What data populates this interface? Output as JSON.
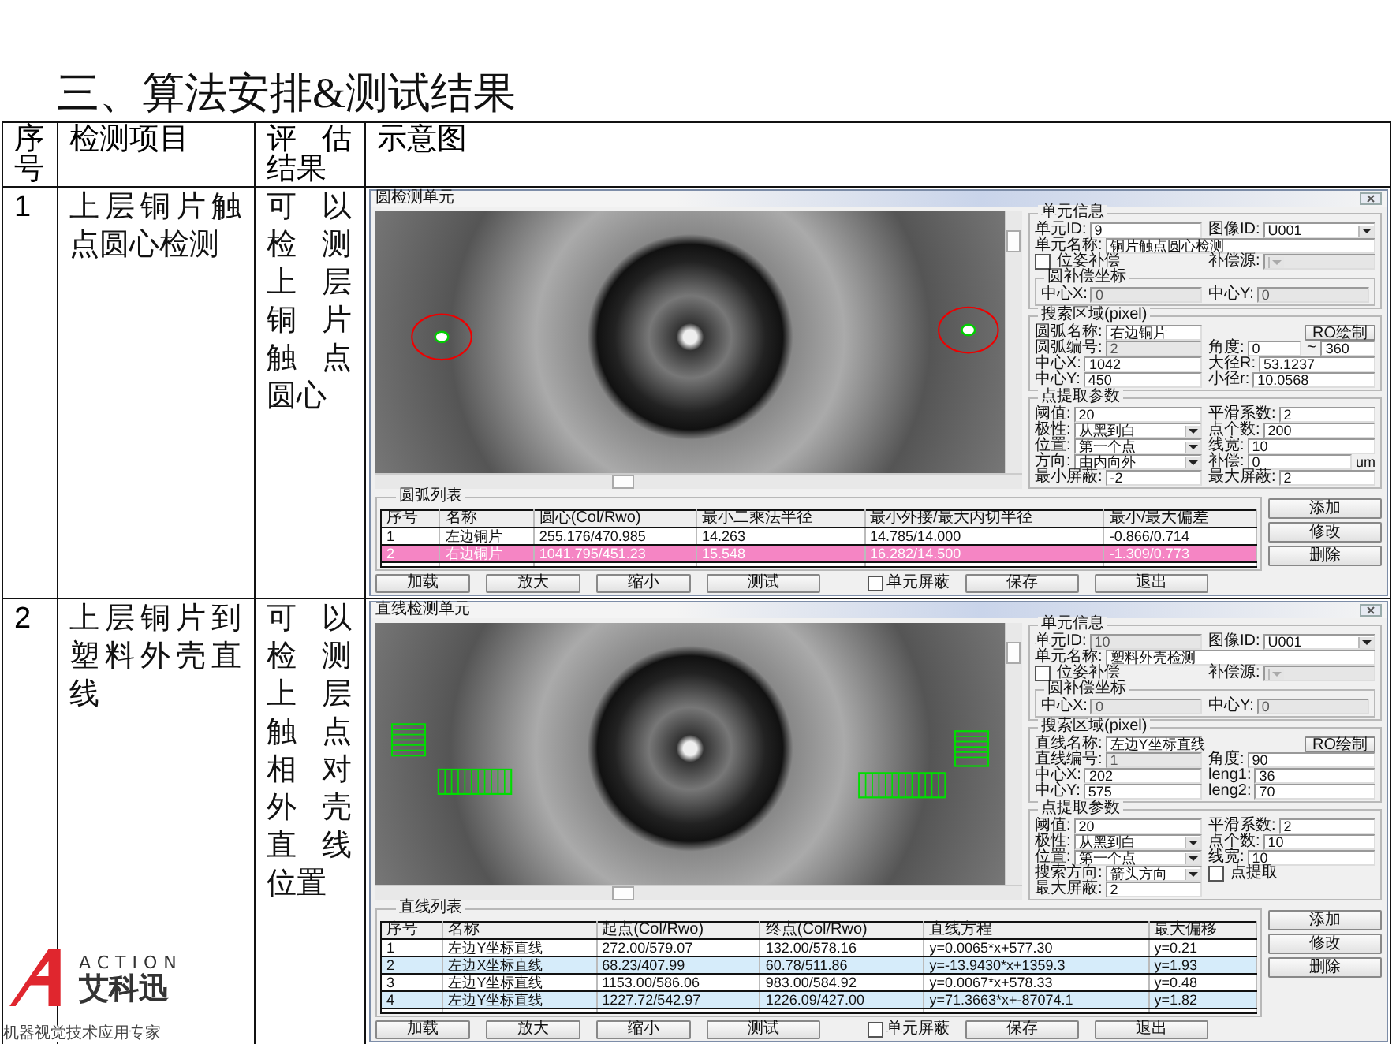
{
  "title": "三、算法安排&测试结果",
  "table": {
    "columns": [
      "序号",
      "检测项目",
      "评估结果",
      "示意图"
    ],
    "rows": [
      {
        "index": "1",
        "item": "上层铜片触点圆心检测",
        "result": "可以检测上层铜片触点圆心",
        "window": {
          "title": "圆检测单元",
          "kind": "circle",
          "groups": [
            {
              "title": "单元信息",
              "fields": [
                {
                  "kind": "input",
                  "label": "单元ID:",
                  "value": "9"
                },
                {
                  "kind": "select",
                  "label": "图像ID:",
                  "value": "U001"
                },
                {
                  "kind": "textline",
                  "label": "单元名称:",
                  "value": "铜片触点圆心检测"
                },
                {
                  "kind": "checkbox",
                  "label": "位姿补偿",
                  "checked": false
                },
                {
                  "kind": "select",
                  "label": "补偿源:",
                  "disabled": true
                }
              ],
              "sub": {
                "title": "圆补偿坐标",
                "fields": [
                  {
                    "kind": "input",
                    "label": "中心X:",
                    "value": "0",
                    "disabled": true
                  },
                  {
                    "kind": "input",
                    "label": "中心Y:",
                    "value": "0",
                    "disabled": true
                  }
                ]
              }
            },
            {
              "title": "搜索区域(pixel)",
              "fields": [
                {
                  "kind": "input",
                  "label": "圆弧名称:",
                  "value": "右边铜片"
                },
                {
                  "kind": "button",
                  "label": "RO绘制"
                },
                {
                  "kind": "input",
                  "label": "圆弧编号:",
                  "value": "2",
                  "disabled": true
                },
                {
                  "kind": "range",
                  "label": "角度:",
                  "value": "0",
                  "sep": "~",
                  "value2": "360"
                },
                {
                  "kind": "input",
                  "label": "中心X:",
                  "value": "1042"
                },
                {
                  "kind": "input",
                  "label": "大径R:",
                  "value": "53.1237"
                },
                {
                  "kind": "input",
                  "label": "中心Y:",
                  "value": "450"
                },
                {
                  "kind": "input",
                  "label": "小径r:",
                  "value": "10.0568"
                }
              ]
            },
            {
              "title": "点提取参数",
              "fields": [
                {
                  "kind": "input",
                  "label": "阈值:",
                  "value": "20"
                },
                {
                  "kind": "input",
                  "label": "平滑系数:",
                  "value": "2"
                },
                {
                  "kind": "select",
                  "label": "极性:",
                  "value": "从黑到白"
                },
                {
                  "kind": "input",
                  "label": "点个数:",
                  "value": "200"
                },
                {
                  "kind": "select",
                  "label": "位置:",
                  "value": "第一个点"
                },
                {
                  "kind": "input",
                  "label": "线宽:",
                  "value": "10"
                },
                {
                  "kind": "select",
                  "label": "方向:",
                  "value": "由内向外"
                },
                {
                  "kind": "input",
                  "label": "补偿:",
                  "value": "0",
                  "unit": "um"
                },
                {
                  "kind": "input",
                  "label": "最小屏蔽:",
                  "value": "-2"
                },
                {
                  "kind": "input",
                  "label": "最大屏蔽:",
                  "value": "2"
                }
              ]
            }
          ],
          "list": {
            "title": "圆弧列表",
            "columns": [
              "序号",
              "名称",
              "圆心(Col/Rwo)",
              "最小二乘法半径",
              "最小外接/最大内切半径",
              "最小/最大偏差"
            ],
            "rows": [
              {
                "cells": [
                  "1",
                  "左边铜片",
                  "255.176/470.985",
                  "14.263",
                  "14.785/14.000",
                  "-0.866/0.714"
                ],
                "selected": false
              },
              {
                "cells": [
                  "2",
                  "右边铜片",
                  "1041.795/451.23",
                  "15.548",
                  "16.282/14.500",
                  "-1.309/0.773"
                ],
                "selected": true
              }
            ]
          },
          "side_buttons": [
            "添加",
            "修改",
            "删除"
          ],
          "buttons": [
            "加载",
            "放大",
            "缩小",
            "测试"
          ],
          "mask": {
            "label": "单元屏蔽",
            "checked": false
          },
          "actions": [
            "保存",
            "退出"
          ]
        }
      },
      {
        "index": "2",
        "item": "上层铜片到塑料外壳直线",
        "result": "可以检测上层触点相对外壳直线位置",
        "window": {
          "title": "直线检测单元",
          "kind": "line",
          "groups": [
            {
              "title": "单元信息",
              "fields": [
                {
                  "kind": "input",
                  "label": "单元ID:",
                  "value": "10",
                  "disabled": true
                },
                {
                  "kind": "select",
                  "label": "图像ID:",
                  "value": "U001"
                },
                {
                  "kind": "textline",
                  "label": "单元名称:",
                  "value": "塑料外壳检测"
                },
                {
                  "kind": "checkbox",
                  "label": "位姿补偿",
                  "checked": false
                },
                {
                  "kind": "select",
                  "label": "补偿源:",
                  "disabled": true
                }
              ],
              "sub": {
                "title": "圆补偿坐标",
                "fields": [
                  {
                    "kind": "input",
                    "label": "中心X:",
                    "value": "0",
                    "disabled": true
                  },
                  {
                    "kind": "input",
                    "label": "中心Y:",
                    "value": "0",
                    "disabled": true
                  }
                ]
              }
            },
            {
              "title": "搜索区域(pixel)",
              "fields": [
                {
                  "kind": "input",
                  "label": "直线名称:",
                  "value": "左边Y坐标直线"
                },
                {
                  "kind": "button",
                  "label": "RO绘制"
                },
                {
                  "kind": "input",
                  "label": "直线编号:",
                  "value": "1",
                  "disabled": true
                },
                {
                  "kind": "input",
                  "label": "角度:",
                  "value": "90"
                },
                {
                  "kind": "input",
                  "label": "中心X:",
                  "value": "202"
                },
                {
                  "kind": "input",
                  "label": "leng1:",
                  "value": "36"
                },
                {
                  "kind": "input",
                  "label": "中心Y:",
                  "value": "575"
                },
                {
                  "kind": "input",
                  "label": "leng2:",
                  "value": "70"
                }
              ]
            },
            {
              "title": "点提取参数",
              "fields": [
                {
                  "kind": "input",
                  "label": "阈值:",
                  "value": "20"
                },
                {
                  "kind": "input",
                  "label": "平滑系数:",
                  "value": "2"
                },
                {
                  "kind": "select",
                  "label": "极性:",
                  "value": "从黑到白"
                },
                {
                  "kind": "input",
                  "label": "点个数:",
                  "value": "10"
                },
                {
                  "kind": "select",
                  "label": "位置:",
                  "value": "第一个点"
                },
                {
                  "kind": "input",
                  "label": "线宽:",
                  "value": "10"
                },
                {
                  "kind": "select",
                  "label": "搜索方向:",
                  "value": "箭头方向"
                },
                {
                  "kind": "checkbox",
                  "label": "点提取",
                  "checked": false
                },
                {
                  "kind": "input",
                  "label": "最大屏蔽:",
                  "value": "2"
                }
              ]
            }
          ],
          "list": {
            "title": "直线列表",
            "columns": [
              "序号",
              "名称",
              "起点(Col/Rwo)",
              "终点(Col/Rwo)",
              "直线方程",
              "最大偏移"
            ],
            "rows": [
              {
                "cells": [
                  "1",
                  "左边Y坐标直线",
                  "272.00/579.07",
                  "132.00/578.16",
                  "y=0.0065*x+577.30",
                  "y=0.21"
                ],
                "selected": false
              },
              {
                "cells": [
                  "2",
                  "左边X坐标直线",
                  "68.23/407.99",
                  "60.78/511.86",
                  "y=-13.9430*x+1359.3",
                  "y=1.93"
                ],
                "selected": false
              },
              {
                "cells": [
                  "3",
                  "左边Y坐标直线",
                  "1153.00/586.06",
                  "983.00/584.92",
                  "y=0.0067*x+578.33",
                  "y=0.48"
                ],
                "selected": false
              },
              {
                "cells": [
                  "4",
                  "左边Y坐标直线",
                  "1227.72/542.97",
                  "1226.09/427.00",
                  "y=71.3663*x+-87074.1",
                  "y=1.82"
                ],
                "selected": false
              }
            ]
          },
          "side_buttons": [
            "添加",
            "修改",
            "删除"
          ],
          "buttons": [
            "加载",
            "放大",
            "缩小",
            "测试"
          ],
          "mask": {
            "label": "单元屏蔽",
            "checked": false
          },
          "actions": [
            "保存",
            "退出"
          ]
        }
      }
    ]
  },
  "logo": {
    "wordmark": "ACTION",
    "name": "艾科迅",
    "tagline": "机器视觉技术应用专家"
  }
}
